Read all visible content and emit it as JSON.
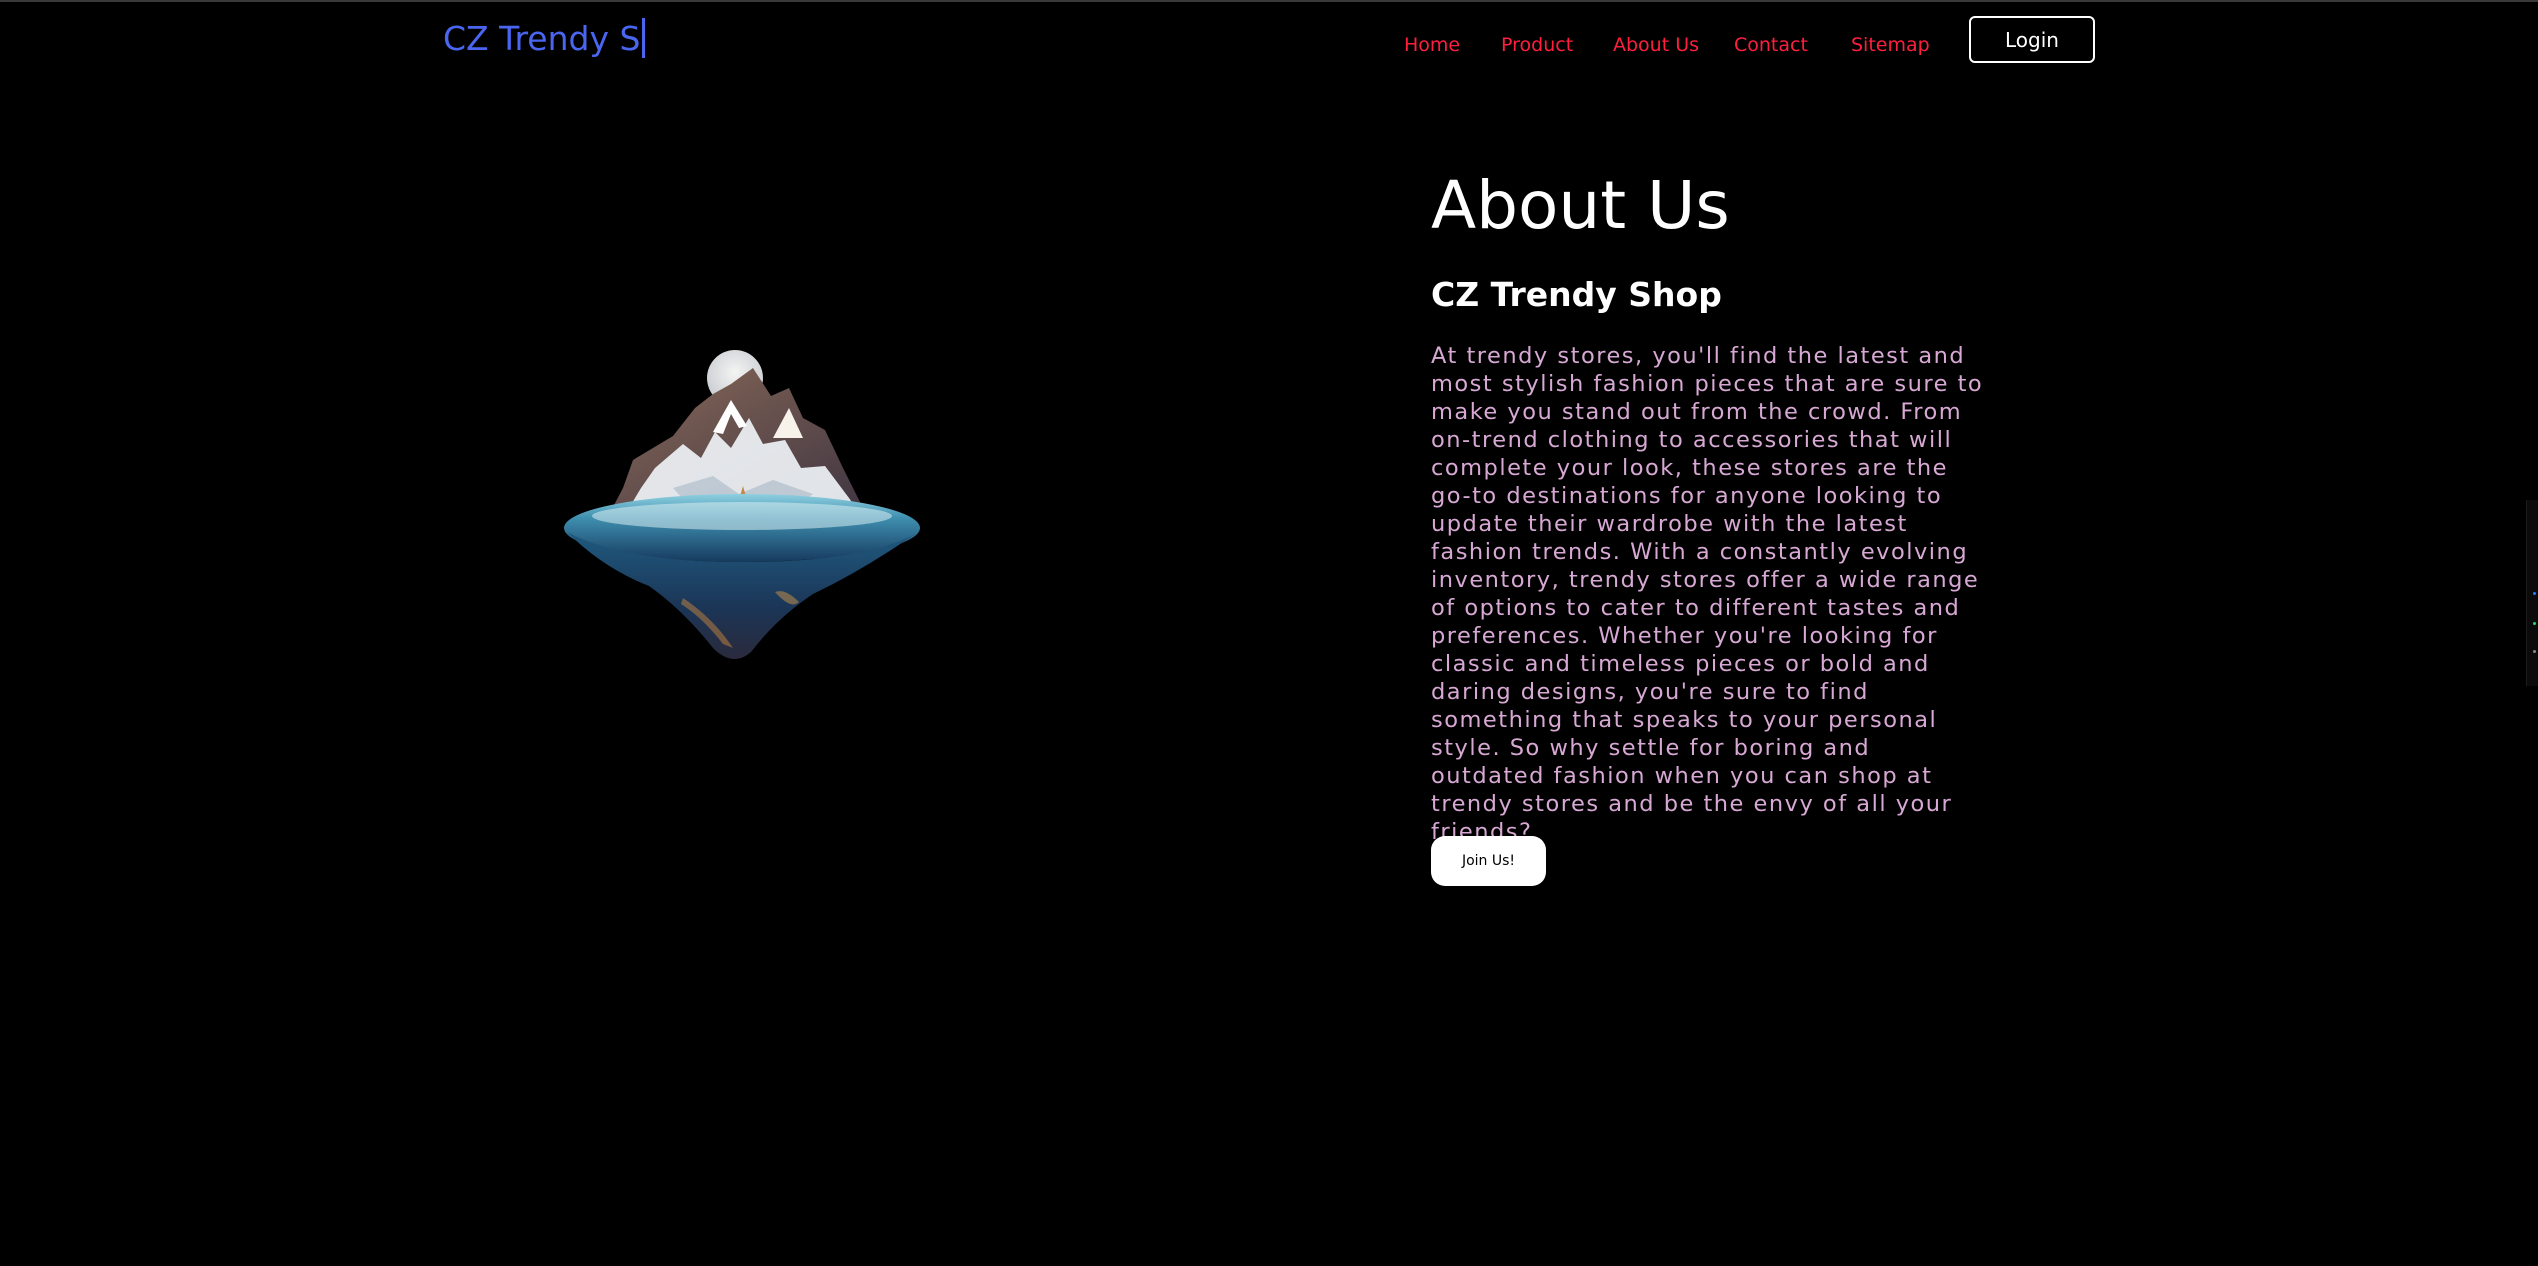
{
  "header": {
    "logo_text": "CZ Trendy S",
    "nav": [
      {
        "label": "Home"
      },
      {
        "label": "Product"
      },
      {
        "label": "About Us"
      },
      {
        "label": "Contact"
      },
      {
        "label": "Sitemap"
      }
    ],
    "login_label": "Login"
  },
  "main": {
    "heading": "About Us",
    "subheading": "CZ Trendy Shop",
    "paragraph": "At trendy stores, you'll find the latest and most stylish fashion pieces that are sure to make you stand out from the crowd. From on-trend clothing to accessories that will complete your look, these stores are the go-to destinations for anyone looking to update their wardrobe with the latest fashion trends. With a constantly evolving inventory, trendy stores offer a wide range of options to cater to different tastes and preferences. Whether you're looking for classic and timeless pieces or bold and daring designs, you're sure to find something that speaks to your personal style. So why settle for boring and outdated fashion when you can shop at trendy stores and be the envy of all your friends?",
    "join_label": "Join Us!"
  },
  "colors": {
    "background": "#000000",
    "logo": "#4a66f0",
    "nav_link": "#ff1f3d",
    "paragraph": "#d7a8d4",
    "button_bg": "#ffffff"
  },
  "images": {
    "hero": "floating-island-image"
  }
}
